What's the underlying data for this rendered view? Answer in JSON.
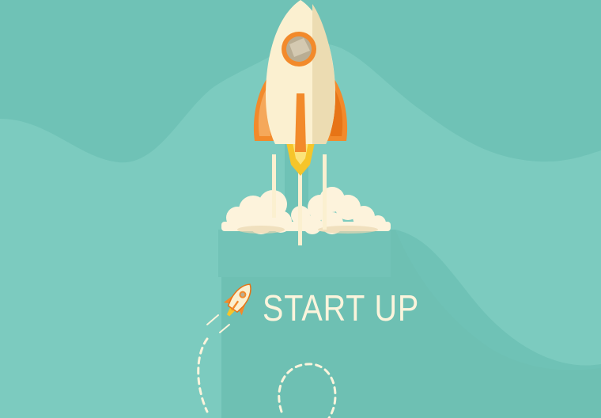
{
  "headline": "START UP",
  "colors": {
    "background": "#6fc2b6",
    "hill": "#7ccbbf",
    "rocket_body": "#fbf0d0",
    "rocket_fin": "#f28a2b",
    "flame": "#f6c52a",
    "cloud": "#fdf3dc",
    "text": "#fbf4dc"
  },
  "icons": {
    "big_rocket": "rocket-icon",
    "small_rocket": "rocket-icon"
  }
}
